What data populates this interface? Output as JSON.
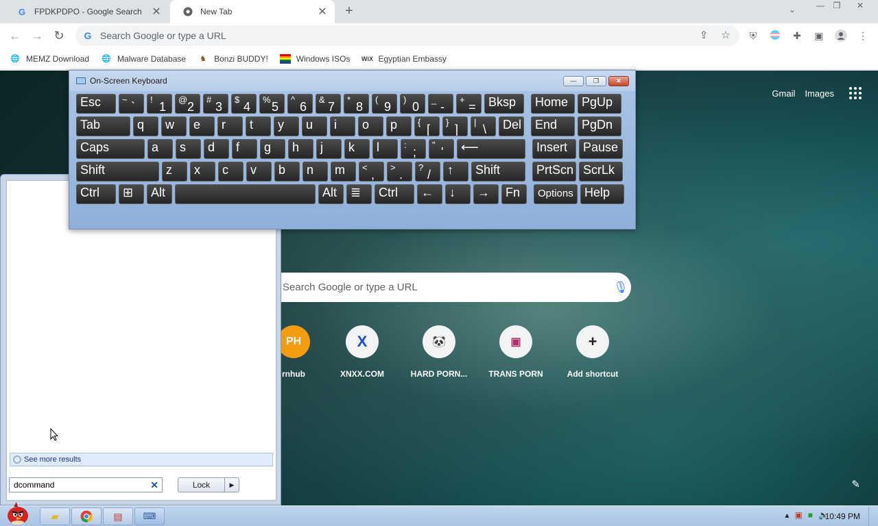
{
  "browser": {
    "tabs": [
      {
        "label": "FPDKPDPO - Google Search",
        "favicon": "google-icon"
      },
      {
        "label": "New Tab",
        "favicon": "chrome-icon"
      }
    ],
    "new_tab_symbol": "+",
    "omnibox_placeholder": "Search Google or type a URL",
    "bookmarks": [
      {
        "label": "MEMZ Download",
        "icon": "globe-icon"
      },
      {
        "label": "Malware Database",
        "icon": "globe-icon"
      },
      {
        "label": "Bonzi BUDDY!",
        "icon": "bonzi-icon"
      },
      {
        "label": "Windows ISOs",
        "icon": "windows-flag-icon"
      },
      {
        "label": "Egyptian Embassy",
        "icon": "wix-icon"
      }
    ]
  },
  "ntp": {
    "links": {
      "gmail": "Gmail",
      "images": "Images"
    },
    "search_placeholder": "Search Google or type a URL",
    "shortcuts": [
      {
        "label": "rnhub",
        "badge": "PH"
      },
      {
        "label": "XNXX.COM",
        "badge": "X"
      },
      {
        "label": "HARD PORN...",
        "badge": "🐼"
      },
      {
        "label": "TRANS PORN",
        "badge": "▣"
      },
      {
        "label": "Add shortcut",
        "badge": "+"
      }
    ]
  },
  "osk": {
    "title": "On-Screen Keyboard",
    "rows": [
      [
        [
          "Esc",
          ""
        ],
        [
          "`",
          "~"
        ],
        [
          "1",
          "!"
        ],
        [
          "2",
          "@"
        ],
        [
          "3",
          "#"
        ],
        [
          "4",
          "$"
        ],
        [
          "5",
          "%"
        ],
        [
          "6",
          "^"
        ],
        [
          "7",
          "&"
        ],
        [
          "8",
          "*"
        ],
        [
          "9",
          "("
        ],
        [
          "0",
          ")"
        ],
        [
          "-",
          "_"
        ],
        [
          "=",
          "+"
        ],
        [
          "Bksp",
          ""
        ],
        [
          "Home",
          ""
        ],
        [
          "PgUp",
          ""
        ]
      ],
      [
        [
          "Tab",
          ""
        ],
        [
          "q",
          ""
        ],
        [
          "w",
          ""
        ],
        [
          "e",
          ""
        ],
        [
          "r",
          ""
        ],
        [
          "t",
          ""
        ],
        [
          "y",
          ""
        ],
        [
          "u",
          ""
        ],
        [
          "i",
          ""
        ],
        [
          "o",
          ""
        ],
        [
          "p",
          ""
        ],
        [
          "[",
          "{"
        ],
        [
          "]",
          "}"
        ],
        [
          "\\",
          "|"
        ],
        [
          "Del",
          ""
        ],
        [
          "End",
          ""
        ],
        [
          "PgDn",
          ""
        ]
      ],
      [
        [
          "Caps",
          ""
        ],
        [
          "a",
          ""
        ],
        [
          "s",
          ""
        ],
        [
          "d",
          ""
        ],
        [
          "f",
          ""
        ],
        [
          "g",
          ""
        ],
        [
          "h",
          ""
        ],
        [
          "j",
          ""
        ],
        [
          "k",
          ""
        ],
        [
          "l",
          ""
        ],
        [
          ";",
          ":"
        ],
        [
          "'",
          "\""
        ],
        [
          "⟵",
          ""
        ],
        [
          "Insert",
          ""
        ],
        [
          "Pause",
          ""
        ]
      ],
      [
        [
          "Shift",
          ""
        ],
        [
          "z",
          ""
        ],
        [
          "x",
          ""
        ],
        [
          "c",
          ""
        ],
        [
          "v",
          ""
        ],
        [
          "b",
          ""
        ],
        [
          "n",
          ""
        ],
        [
          "m",
          ""
        ],
        [
          ",",
          "<"
        ],
        [
          ".",
          ">"
        ],
        [
          "/",
          "?"
        ],
        [
          "↑",
          ""
        ],
        [
          "Shift",
          ""
        ],
        [
          "PrtScn",
          ""
        ],
        [
          "ScrLk",
          ""
        ]
      ],
      [
        [
          "Ctrl",
          ""
        ],
        [
          "⊞",
          ""
        ],
        [
          "Alt",
          ""
        ],
        [
          "",
          ""
        ],
        [
          "Alt",
          ""
        ],
        [
          "≣",
          ""
        ],
        [
          "Ctrl",
          ""
        ],
        [
          "←",
          ""
        ],
        [
          "↓",
          ""
        ],
        [
          "→",
          ""
        ],
        [
          "Fn",
          ""
        ],
        [
          "Options",
          ""
        ],
        [
          "Help",
          ""
        ]
      ]
    ]
  },
  "start_menu": {
    "see_more": "See more results",
    "search_value": "dcommand",
    "lock_label": "Lock"
  },
  "taskbar": {
    "clock": "10:49 PM"
  }
}
